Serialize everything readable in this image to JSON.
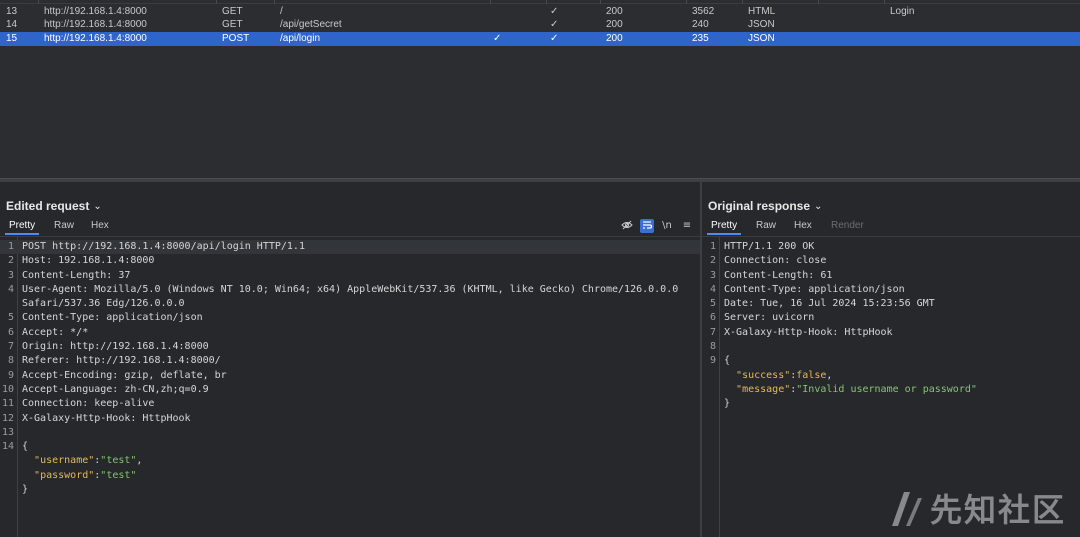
{
  "history": {
    "rows": [
      {
        "num": "13",
        "host": "http://192.168.1.4:8000",
        "method": "GET",
        "url": "/",
        "edited": "",
        "modified": "✓",
        "status": "200",
        "length": "3562",
        "mime": "HTML",
        "title": "Login"
      },
      {
        "num": "14",
        "host": "http://192.168.1.4:8000",
        "method": "GET",
        "url": "/api/getSecret",
        "edited": "",
        "modified": "✓",
        "status": "200",
        "length": "240",
        "mime": "JSON",
        "title": ""
      },
      {
        "num": "15",
        "host": "http://192.168.1.4:8000",
        "method": "POST",
        "url": "/api/login",
        "edited": "✓",
        "modified": "✓",
        "status": "200",
        "length": "235",
        "mime": "JSON",
        "title": ""
      }
    ]
  },
  "request": {
    "title": "Edited request",
    "tabs": [
      "Pretty",
      "Raw",
      "Hex"
    ],
    "lines": [
      {
        "n": "1",
        "text": "POST http://192.168.1.4:8000/api/login HTTP/1.1"
      },
      {
        "n": "2",
        "text": "Host: 192.168.1.4:8000"
      },
      {
        "n": "3",
        "text": "Content-Length: 37"
      },
      {
        "n": "4",
        "text": "User-Agent: Mozilla/5.0 (Windows NT 10.0; Win64; x64) AppleWebKit/537.36 (KHTML, like Gecko) Chrome/126.0.0.0"
      },
      {
        "n": "",
        "text": "Safari/537.36 Edg/126.0.0.0"
      },
      {
        "n": "5",
        "text": "Content-Type: application/json"
      },
      {
        "n": "6",
        "text": "Accept: */*"
      },
      {
        "n": "7",
        "text": "Origin: http://192.168.1.4:8000"
      },
      {
        "n": "8",
        "text": "Referer: http://192.168.1.4:8000/"
      },
      {
        "n": "9",
        "text": "Accept-Encoding: gzip, deflate, br"
      },
      {
        "n": "10",
        "text": "Accept-Language: zh-CN,zh;q=0.9"
      },
      {
        "n": "11",
        "text": "Connection: keep-alive"
      },
      {
        "n": "12",
        "text": "X-Galaxy-Http-Hook: HttpHook"
      },
      {
        "n": "13",
        "text": ""
      },
      {
        "n": "14",
        "text": "{"
      },
      {
        "n": "",
        "text": "  \"username\":\"test\","
      },
      {
        "n": "",
        "text": "  \"password\":\"test\""
      },
      {
        "n": "",
        "text": "}"
      }
    ]
  },
  "response": {
    "title": "Original response",
    "tabs": [
      "Pretty",
      "Raw",
      "Hex",
      "Render"
    ],
    "lines": [
      {
        "n": "1",
        "text": "HTTP/1.1 200 OK"
      },
      {
        "n": "2",
        "text": "Connection: close"
      },
      {
        "n": "3",
        "text": "Content-Length: 61"
      },
      {
        "n": "4",
        "text": "Content-Type: application/json"
      },
      {
        "n": "5",
        "text": "Date: Tue, 16 Jul 2024 15:23:56 GMT"
      },
      {
        "n": "6",
        "text": "Server: uvicorn"
      },
      {
        "n": "7",
        "text": "X-Galaxy-Http-Hook: HttpHook"
      },
      {
        "n": "8",
        "text": ""
      },
      {
        "n": "9",
        "text": "{"
      },
      {
        "n": "",
        "text": "  \"success\":false,"
      },
      {
        "n": "",
        "text": "  \"message\":\"Invalid username or password\""
      },
      {
        "n": "",
        "text": "}"
      }
    ]
  },
  "tools": {
    "hide_icon": "eye-off-icon",
    "wrap_icon": "word-wrap-icon",
    "newline_label": "\\n",
    "menu_icon": "hamburger-menu-icon"
  },
  "watermark": {
    "text": "先知社区"
  },
  "colors": {
    "selected_row": "#2f65ca",
    "json_key": "#e6b85c",
    "json_string": "#86c470",
    "active_tab": "#4d8cf5"
  }
}
